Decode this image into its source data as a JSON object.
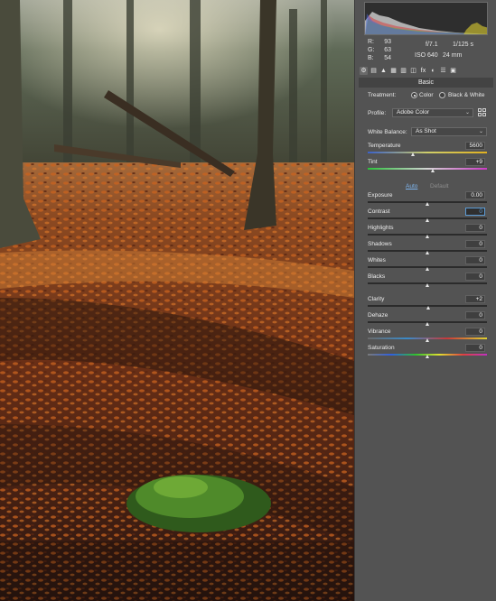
{
  "histogram": {
    "rgb_labels": [
      "R:",
      "G:",
      "B:"
    ],
    "rgb_values": [
      "93",
      "63",
      "54"
    ],
    "exif": {
      "aperture": "f/7.1",
      "shutter": "1/125 s",
      "iso": "ISO 640",
      "focal": "24 mm"
    }
  },
  "tabs": [
    {
      "icon": "camera-basic-icon",
      "glyph": "⚙",
      "active": true
    },
    {
      "icon": "tone-curve-icon",
      "glyph": "▤"
    },
    {
      "icon": "detail-icon",
      "glyph": "▲"
    },
    {
      "icon": "hsl-icon",
      "glyph": "▦"
    },
    {
      "icon": "split-toning-icon",
      "glyph": "▥"
    },
    {
      "icon": "lens-icon",
      "glyph": "◫"
    },
    {
      "icon": "effects-icon",
      "glyph": "fx"
    },
    {
      "icon": "calibration-icon",
      "glyph": "◐"
    },
    {
      "icon": "presets-icon",
      "glyph": "☰"
    },
    {
      "icon": "snapshots-icon",
      "glyph": "▣"
    }
  ],
  "section_title": "Basic",
  "treatment": {
    "label": "Treatment:",
    "options": [
      "Color",
      "Black & White"
    ],
    "selected": "Color"
  },
  "profile": {
    "label": "Profile:",
    "value": "Adobe Color"
  },
  "white_balance": {
    "label": "White Balance:",
    "value": "As Shot"
  },
  "wb_sliders": [
    {
      "name": "Temperature",
      "value": "5600",
      "position": 0.38
    },
    {
      "name": "Tint",
      "value": "+9",
      "position": 0.55
    }
  ],
  "auto_label": "Auto",
  "default_label": "Default",
  "tone_sliders": [
    {
      "name": "Exposure",
      "value": "0.00",
      "position": 0.5
    },
    {
      "name": "Contrast",
      "value": "0",
      "position": 0.5,
      "focused": true
    },
    {
      "name": "Highlights",
      "value": "0",
      "position": 0.5
    },
    {
      "name": "Shadows",
      "value": "0",
      "position": 0.5
    },
    {
      "name": "Whites",
      "value": "0",
      "position": 0.5
    },
    {
      "name": "Blacks",
      "value": "0",
      "position": 0.5
    }
  ],
  "presence_sliders": [
    {
      "name": "Clarity",
      "value": "+2",
      "position": 0.51
    },
    {
      "name": "Dehaze",
      "value": "0",
      "position": 0.5
    },
    {
      "name": "Vibrance",
      "value": "0",
      "position": 0.5
    },
    {
      "name": "Saturation",
      "value": "0",
      "position": 0.5
    }
  ],
  "colors": {
    "panel_bg": "#535353",
    "focus_blue": "#5b9bd5",
    "autumn_leaves": "#b5521c",
    "moss": "#4f8a2a"
  }
}
